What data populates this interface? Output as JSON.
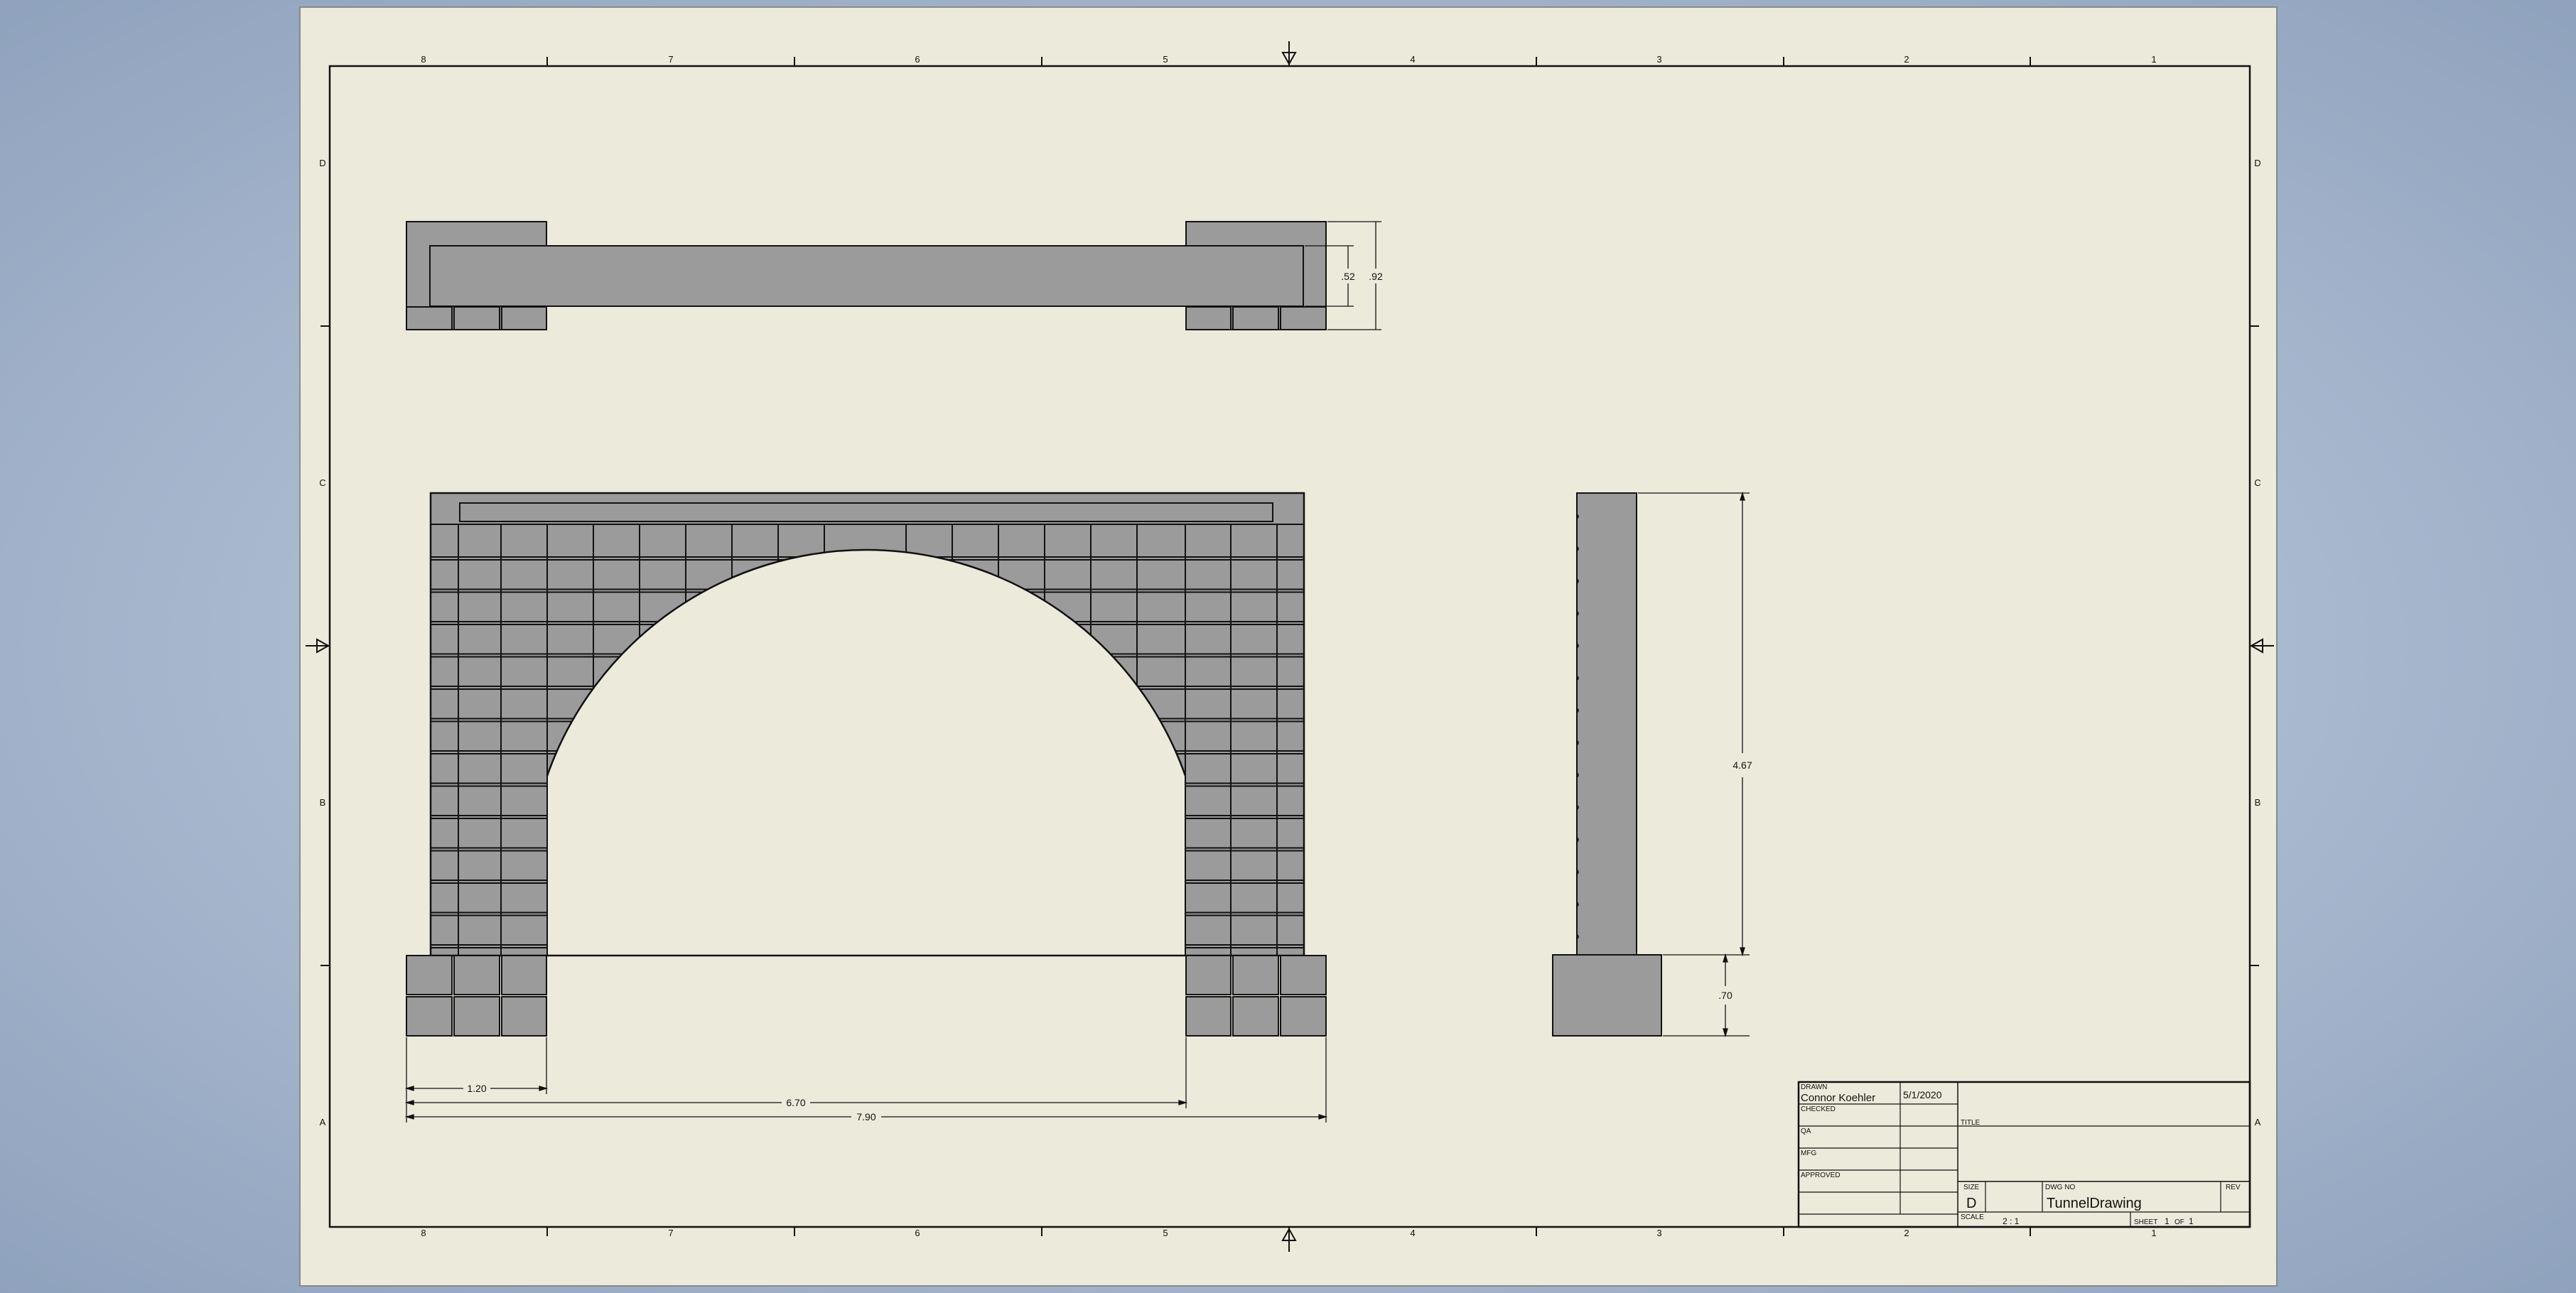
{
  "colors": {
    "paper": "#eceadb",
    "stone": "#9b9b9b",
    "line": "#111111"
  },
  "zone_columns": [
    "8",
    "7",
    "6",
    "5",
    "4",
    "3",
    "2",
    "1"
  ],
  "zone_rows": [
    "D",
    "C",
    "B",
    "A"
  ],
  "dimensions": {
    "top_inner": ".52",
    "top_outer": ".92",
    "side_height": "4.67",
    "side_base": ".70",
    "pier_width": "1.20",
    "arch_span": "6.70",
    "overall_width": "7.90"
  },
  "title_block": {
    "drawn_label": "DRAWN",
    "drawn_by": "Connor Koehler",
    "drawn_date": "5/1/2020",
    "checked_label": "CHECKED",
    "qa_label": "QA",
    "mfg_label": "MFG",
    "approved_label": "APPROVED",
    "title_label": "TITLE",
    "size_label": "SIZE",
    "size_value": "D",
    "dwg_no_label": "DWG NO",
    "dwg_no_value": "TunnelDrawing",
    "rev_label": "REV",
    "scale_label": "SCALE",
    "scale_value": "2 : 1",
    "sheet_label": "SHEET",
    "sheet_number": "1",
    "sheet_of_label": "OF",
    "sheet_total": "1"
  }
}
